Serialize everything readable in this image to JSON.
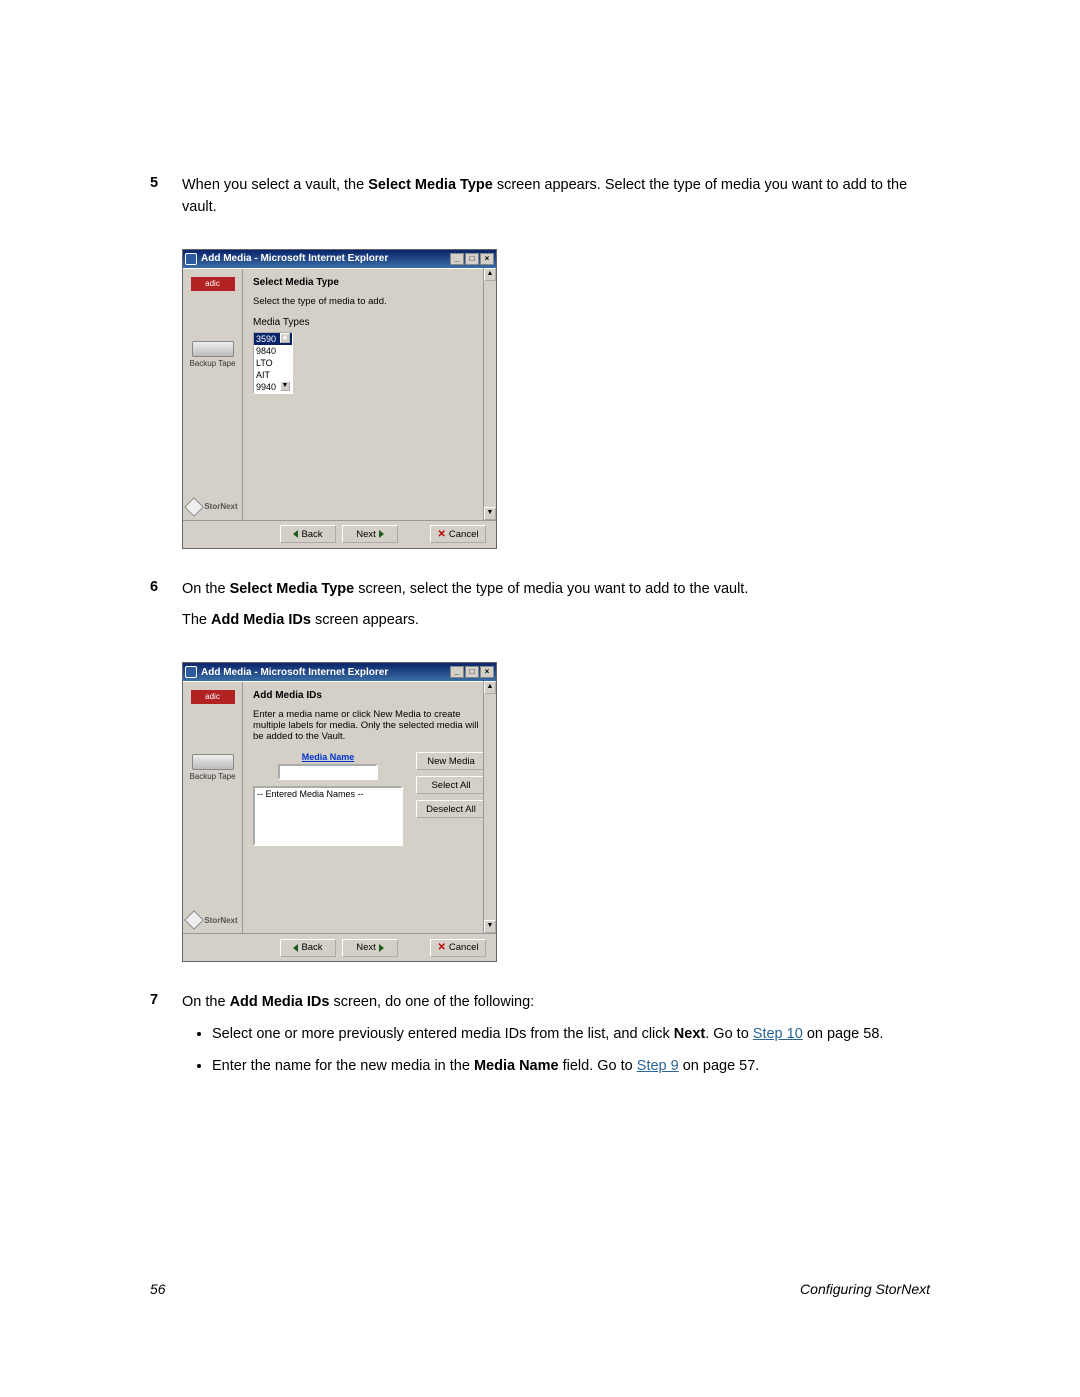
{
  "step5": {
    "num": "5",
    "text_before": "When you select a vault, the ",
    "bold1": "Select Media Type",
    "text_after": " screen appears. Select the type of media you want to add to the vault."
  },
  "step6": {
    "num": "6",
    "text_before": "On the ",
    "bold1": "Select Media Type",
    "text_after": " screen, select the type of media you want to add to the vault.",
    "line2_before": "The ",
    "line2_bold": "Add Media IDs",
    "line2_after": " screen appears."
  },
  "step7": {
    "num": "7",
    "text_before": "On the ",
    "bold1": "Add Media IDs",
    "text_after": " screen, do one of the following:",
    "bullet1_a": "Select one or more previously entered media IDs from the list, and click ",
    "bullet1_bold": "Next",
    "bullet1_b": ". Go to ",
    "bullet1_link": "Step 10",
    "bullet1_c": " on page 58.",
    "bullet2_a": "Enter the name for the new media in the ",
    "bullet2_bold": "Media Name",
    "bullet2_b": " field. Go to ",
    "bullet2_link": "Step 9",
    "bullet2_c": " on page 57."
  },
  "fig1": {
    "title": "Add Media - Microsoft Internet Explorer",
    "heading": "Select Media Type",
    "desc": "Select the type of media to add.",
    "sub": "Media Types",
    "items": {
      "i0": "3590",
      "i1": "9840",
      "i2": "LTO",
      "i3": "AIT",
      "i4": "9940"
    },
    "adic": "adic",
    "backup": "Backup Tape",
    "stornext": "StorNext",
    "btn_back": "Back",
    "btn_next": "Next",
    "btn_cancel": "Cancel"
  },
  "fig2": {
    "title": "Add Media - Microsoft Internet Explorer",
    "heading": "Add Media IDs",
    "desc": "Enter a media name or click New Media to create multiple labels for media. Only the selected media will be added to the Vault.",
    "media_name_label": "Media Name",
    "entered": "-- Entered Media Names --",
    "btn_new": "New Media",
    "btn_selall": "Select All",
    "btn_deselall": "Deselect All",
    "adic": "adic",
    "backup": "Backup Tape",
    "stornext": "StorNext",
    "btn_back": "Back",
    "btn_next": "Next",
    "btn_cancel": "Cancel"
  },
  "footer": {
    "page": "56",
    "title": "Configuring StorNext"
  }
}
